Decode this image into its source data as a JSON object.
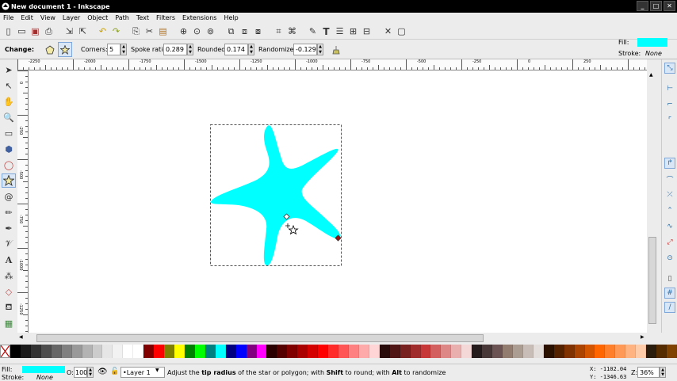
{
  "window": {
    "title": "New document 1 - Inkscape",
    "buttons": [
      "_",
      "□",
      "✕"
    ]
  },
  "menu": [
    "File",
    "Edit",
    "View",
    "Layer",
    "Object",
    "Path",
    "Text",
    "Filters",
    "Extensions",
    "Help"
  ],
  "controls": {
    "change_label": "Change:",
    "corners_label": "Corners:",
    "corners_value": "5",
    "spoke_ratio_label": "Spoke ratio:",
    "spoke_ratio_value": "0.289",
    "rounded_label": "Rounded:",
    "rounded_value": "0.174",
    "randomized_label": "Randomized:",
    "randomized_value": "-0.129"
  },
  "style_panel": {
    "fill_label": "Fill:",
    "stroke_label": "Stroke:",
    "stroke_value": "None",
    "fill_color": "#00ffff"
  },
  "rulers": {
    "horizontal": [
      "-2250",
      "-2000",
      "-1750",
      "-1500",
      "-1250",
      "-1000",
      "-750",
      "-500",
      "-250",
      "0",
      "250"
    ],
    "vertical": [
      "0",
      "-250",
      "-500",
      "-750",
      "-1000",
      "-1250"
    ]
  },
  "canvas": {
    "star_fill": "#00ffff"
  },
  "status": {
    "fill_label": "Fill:",
    "stroke_label": "Stroke:",
    "stroke_value": "None",
    "opacity_label": "O:",
    "opacity_value": "100",
    "layer": "•Layer 1",
    "message_parts": [
      {
        "text": "Adjust the ",
        "bold": false
      },
      {
        "text": "tip radius",
        "bold": true
      },
      {
        "text": " of the star or polygon; with ",
        "bold": false
      },
      {
        "text": "Shift",
        "bold": true
      },
      {
        "text": " to round; with ",
        "bold": false
      },
      {
        "text": "Alt",
        "bold": true
      },
      {
        "text": " to randomize",
        "bold": false
      }
    ],
    "x_coord": "X: -1102.04",
    "y_coord": "Y: -1346.63",
    "zoom_label": "Z:",
    "zoom_value": "36%"
  },
  "palette": [
    "#000000",
    "#1a1a1a",
    "#333333",
    "#4d4d4d",
    "#666666",
    "#808080",
    "#999999",
    "#b3b3b3",
    "#cccccc",
    "#e6e6e6",
    "#f2f2f2",
    "#ffffff",
    "#ffffff",
    "#800000",
    "#ff0000",
    "#808000",
    "#ffff00",
    "#008000",
    "#00ff00",
    "#008080",
    "#00ffff",
    "#000080",
    "#0000ff",
    "#800080",
    "#ff00ff",
    "#2b0000",
    "#550000",
    "#800000",
    "#aa0000",
    "#d40000",
    "#ff0000",
    "#ff2a2a",
    "#ff5555",
    "#ff8080",
    "#ffaaaa",
    "#ffd5d5",
    "#280b0b",
    "#501616",
    "#782121",
    "#a02c2c",
    "#c83737",
    "#d35f5f",
    "#de8787",
    "#e9afaf",
    "#f4d7d7",
    "#241c1c",
    "#483737",
    "#6c5353",
    "#917c6f",
    "#ac9d93",
    "#c8beb7",
    "#e3dedb",
    "#2b1100",
    "#552200",
    "#803300",
    "#aa4400",
    "#d45500",
    "#ff6600",
    "#ff7f2a",
    "#ff9955",
    "#ffb380",
    "#ffccaa",
    "#2b1d0e",
    "#552c00",
    "#804200"
  ]
}
